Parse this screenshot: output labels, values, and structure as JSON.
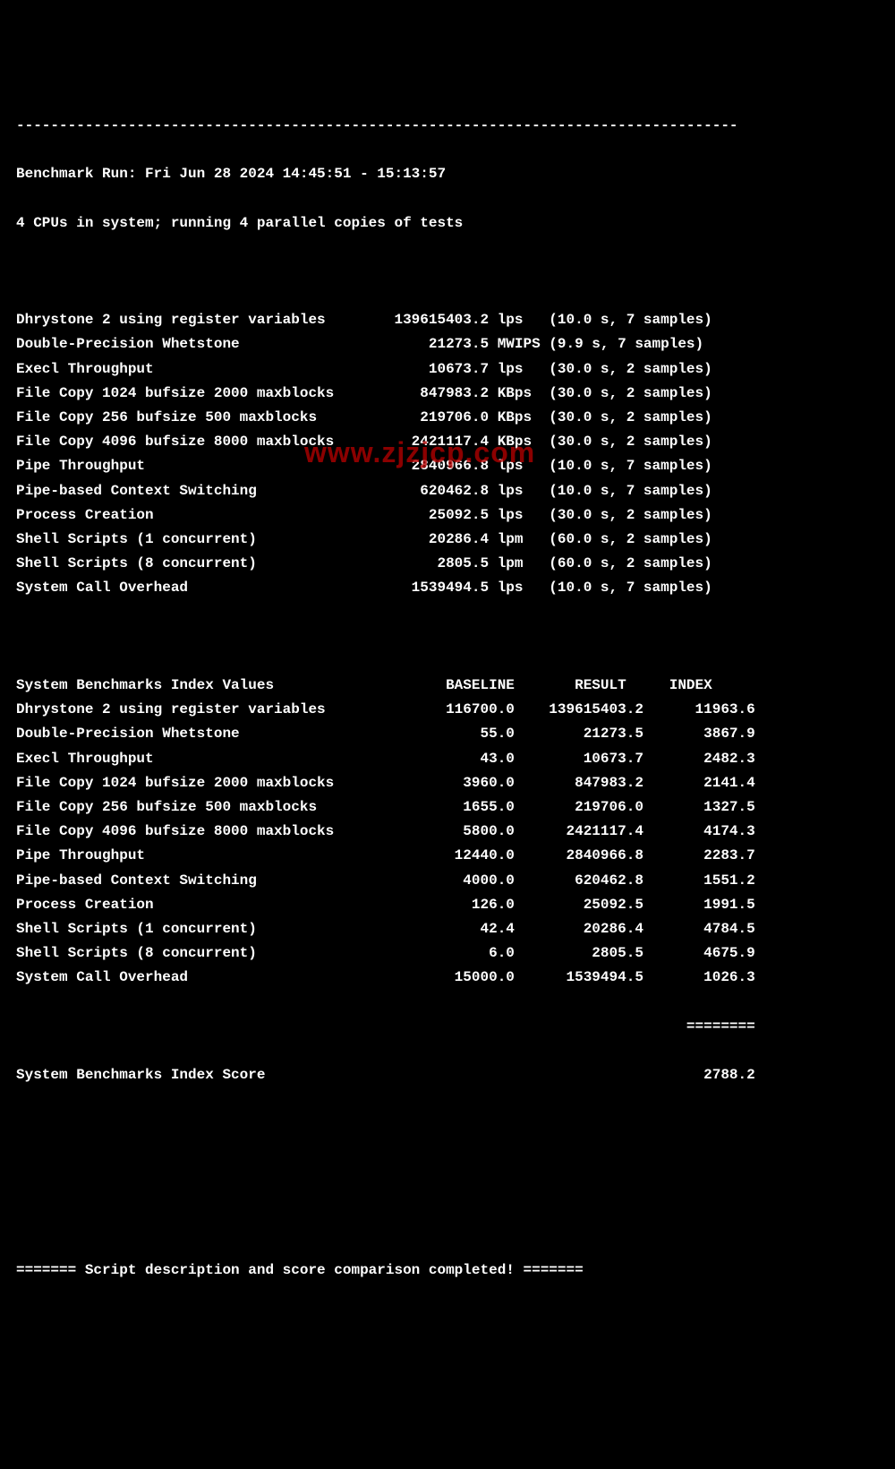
{
  "watermark": "www.zjzjcp.com",
  "header": {
    "divider_top": "------------------------------------------------------------------------------------",
    "run_line": "Benchmark Run: Fri Jun 28 2024 14:45:51 - 15:13:57",
    "cpu_line": "4 CPUs in system; running 4 parallel copies of tests"
  },
  "raw_results": [
    {
      "n": "Dhrystone 2 using register variables",
      "v": "139615403.2",
      "u": "lps",
      "t": "(10.0 s, 7 samples)"
    },
    {
      "n": "Double-Precision Whetstone",
      "v": "21273.5",
      "u": "MWIPS",
      "t": "(9.9 s, 7 samples)"
    },
    {
      "n": "Execl Throughput",
      "v": "10673.7",
      "u": "lps",
      "t": "(30.0 s, 2 samples)"
    },
    {
      "n": "File Copy 1024 bufsize 2000 maxblocks",
      "v": "847983.2",
      "u": "KBps",
      "t": "(30.0 s, 2 samples)"
    },
    {
      "n": "File Copy 256 bufsize 500 maxblocks",
      "v": "219706.0",
      "u": "KBps",
      "t": "(30.0 s, 2 samples)"
    },
    {
      "n": "File Copy 4096 bufsize 8000 maxblocks",
      "v": "2421117.4",
      "u": "KBps",
      "t": "(30.0 s, 2 samples)"
    },
    {
      "n": "Pipe Throughput",
      "v": "2840966.8",
      "u": "lps",
      "t": "(10.0 s, 7 samples)"
    },
    {
      "n": "Pipe-based Context Switching",
      "v": "620462.8",
      "u": "lps",
      "t": "(10.0 s, 7 samples)"
    },
    {
      "n": "Process Creation",
      "v": "25092.5",
      "u": "lps",
      "t": "(30.0 s, 2 samples)"
    },
    {
      "n": "Shell Scripts (1 concurrent)",
      "v": "20286.4",
      "u": "lpm",
      "t": "(60.0 s, 2 samples)"
    },
    {
      "n": "Shell Scripts (8 concurrent)",
      "v": "2805.5",
      "u": "lpm",
      "t": "(60.0 s, 2 samples)"
    },
    {
      "n": "System Call Overhead",
      "v": "1539494.5",
      "u": "lps",
      "t": "(10.0 s, 7 samples)"
    }
  ],
  "index_header": {
    "n": "System Benchmarks Index Values",
    "b": "BASELINE",
    "r": "RESULT",
    "i": "INDEX"
  },
  "index_rows": [
    {
      "n": "Dhrystone 2 using register variables",
      "b": "116700.0",
      "r": "139615403.2",
      "i": "11963.6"
    },
    {
      "n": "Double-Precision Whetstone",
      "b": "55.0",
      "r": "21273.5",
      "i": "3867.9"
    },
    {
      "n": "Execl Throughput",
      "b": "43.0",
      "r": "10673.7",
      "i": "2482.3"
    },
    {
      "n": "File Copy 1024 bufsize 2000 maxblocks",
      "b": "3960.0",
      "r": "847983.2",
      "i": "2141.4"
    },
    {
      "n": "File Copy 256 bufsize 500 maxblocks",
      "b": "1655.0",
      "r": "219706.0",
      "i": "1327.5"
    },
    {
      "n": "File Copy 4096 bufsize 8000 maxblocks",
      "b": "5800.0",
      "r": "2421117.4",
      "i": "4174.3"
    },
    {
      "n": "Pipe Throughput",
      "b": "12440.0",
      "r": "2840966.8",
      "i": "2283.7"
    },
    {
      "n": "Pipe-based Context Switching",
      "b": "4000.0",
      "r": "620462.8",
      "i": "1551.2"
    },
    {
      "n": "Process Creation",
      "b": "126.0",
      "r": "25092.5",
      "i": "1991.5"
    },
    {
      "n": "Shell Scripts (1 concurrent)",
      "b": "42.4",
      "r": "20286.4",
      "i": "4784.5"
    },
    {
      "n": "Shell Scripts (8 concurrent)",
      "b": "6.0",
      "r": "2805.5",
      "i": "4675.9"
    },
    {
      "n": "System Call Overhead",
      "b": "15000.0",
      "r": "1539494.5",
      "i": "1026.3"
    }
  ],
  "score": {
    "divider": "                                                                              ========",
    "label": "System Benchmarks Index Score",
    "value": "2788.2"
  },
  "footer": "======= Script description and score comparison completed! ======="
}
